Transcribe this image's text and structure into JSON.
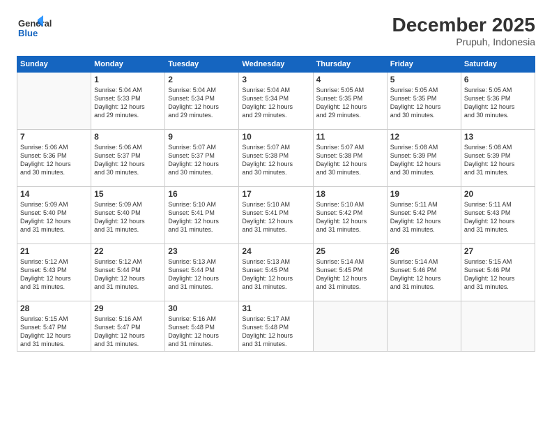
{
  "header": {
    "logo_general": "General",
    "logo_blue": "Blue",
    "month": "December 2025",
    "location": "Prupuh, Indonesia"
  },
  "days_of_week": [
    "Sunday",
    "Monday",
    "Tuesday",
    "Wednesday",
    "Thursday",
    "Friday",
    "Saturday"
  ],
  "weeks": [
    [
      {
        "day": "",
        "info": ""
      },
      {
        "day": "1",
        "info": "Sunrise: 5:04 AM\nSunset: 5:33 PM\nDaylight: 12 hours\nand 29 minutes."
      },
      {
        "day": "2",
        "info": "Sunrise: 5:04 AM\nSunset: 5:34 PM\nDaylight: 12 hours\nand 29 minutes."
      },
      {
        "day": "3",
        "info": "Sunrise: 5:04 AM\nSunset: 5:34 PM\nDaylight: 12 hours\nand 29 minutes."
      },
      {
        "day": "4",
        "info": "Sunrise: 5:05 AM\nSunset: 5:35 PM\nDaylight: 12 hours\nand 29 minutes."
      },
      {
        "day": "5",
        "info": "Sunrise: 5:05 AM\nSunset: 5:35 PM\nDaylight: 12 hours\nand 30 minutes."
      },
      {
        "day": "6",
        "info": "Sunrise: 5:05 AM\nSunset: 5:36 PM\nDaylight: 12 hours\nand 30 minutes."
      }
    ],
    [
      {
        "day": "7",
        "info": "Sunrise: 5:06 AM\nSunset: 5:36 PM\nDaylight: 12 hours\nand 30 minutes."
      },
      {
        "day": "8",
        "info": "Sunrise: 5:06 AM\nSunset: 5:37 PM\nDaylight: 12 hours\nand 30 minutes."
      },
      {
        "day": "9",
        "info": "Sunrise: 5:07 AM\nSunset: 5:37 PM\nDaylight: 12 hours\nand 30 minutes."
      },
      {
        "day": "10",
        "info": "Sunrise: 5:07 AM\nSunset: 5:38 PM\nDaylight: 12 hours\nand 30 minutes."
      },
      {
        "day": "11",
        "info": "Sunrise: 5:07 AM\nSunset: 5:38 PM\nDaylight: 12 hours\nand 30 minutes."
      },
      {
        "day": "12",
        "info": "Sunrise: 5:08 AM\nSunset: 5:39 PM\nDaylight: 12 hours\nand 30 minutes."
      },
      {
        "day": "13",
        "info": "Sunrise: 5:08 AM\nSunset: 5:39 PM\nDaylight: 12 hours\nand 31 minutes."
      }
    ],
    [
      {
        "day": "14",
        "info": "Sunrise: 5:09 AM\nSunset: 5:40 PM\nDaylight: 12 hours\nand 31 minutes."
      },
      {
        "day": "15",
        "info": "Sunrise: 5:09 AM\nSunset: 5:40 PM\nDaylight: 12 hours\nand 31 minutes."
      },
      {
        "day": "16",
        "info": "Sunrise: 5:10 AM\nSunset: 5:41 PM\nDaylight: 12 hours\nand 31 minutes."
      },
      {
        "day": "17",
        "info": "Sunrise: 5:10 AM\nSunset: 5:41 PM\nDaylight: 12 hours\nand 31 minutes."
      },
      {
        "day": "18",
        "info": "Sunrise: 5:10 AM\nSunset: 5:42 PM\nDaylight: 12 hours\nand 31 minutes."
      },
      {
        "day": "19",
        "info": "Sunrise: 5:11 AM\nSunset: 5:42 PM\nDaylight: 12 hours\nand 31 minutes."
      },
      {
        "day": "20",
        "info": "Sunrise: 5:11 AM\nSunset: 5:43 PM\nDaylight: 12 hours\nand 31 minutes."
      }
    ],
    [
      {
        "day": "21",
        "info": "Sunrise: 5:12 AM\nSunset: 5:43 PM\nDaylight: 12 hours\nand 31 minutes."
      },
      {
        "day": "22",
        "info": "Sunrise: 5:12 AM\nSunset: 5:44 PM\nDaylight: 12 hours\nand 31 minutes."
      },
      {
        "day": "23",
        "info": "Sunrise: 5:13 AM\nSunset: 5:44 PM\nDaylight: 12 hours\nand 31 minutes."
      },
      {
        "day": "24",
        "info": "Sunrise: 5:13 AM\nSunset: 5:45 PM\nDaylight: 12 hours\nand 31 minutes."
      },
      {
        "day": "25",
        "info": "Sunrise: 5:14 AM\nSunset: 5:45 PM\nDaylight: 12 hours\nand 31 minutes."
      },
      {
        "day": "26",
        "info": "Sunrise: 5:14 AM\nSunset: 5:46 PM\nDaylight: 12 hours\nand 31 minutes."
      },
      {
        "day": "27",
        "info": "Sunrise: 5:15 AM\nSunset: 5:46 PM\nDaylight: 12 hours\nand 31 minutes."
      }
    ],
    [
      {
        "day": "28",
        "info": "Sunrise: 5:15 AM\nSunset: 5:47 PM\nDaylight: 12 hours\nand 31 minutes."
      },
      {
        "day": "29",
        "info": "Sunrise: 5:16 AM\nSunset: 5:47 PM\nDaylight: 12 hours\nand 31 minutes."
      },
      {
        "day": "30",
        "info": "Sunrise: 5:16 AM\nSunset: 5:48 PM\nDaylight: 12 hours\nand 31 minutes."
      },
      {
        "day": "31",
        "info": "Sunrise: 5:17 AM\nSunset: 5:48 PM\nDaylight: 12 hours\nand 31 minutes."
      },
      {
        "day": "",
        "info": ""
      },
      {
        "day": "",
        "info": ""
      },
      {
        "day": "",
        "info": ""
      }
    ]
  ]
}
